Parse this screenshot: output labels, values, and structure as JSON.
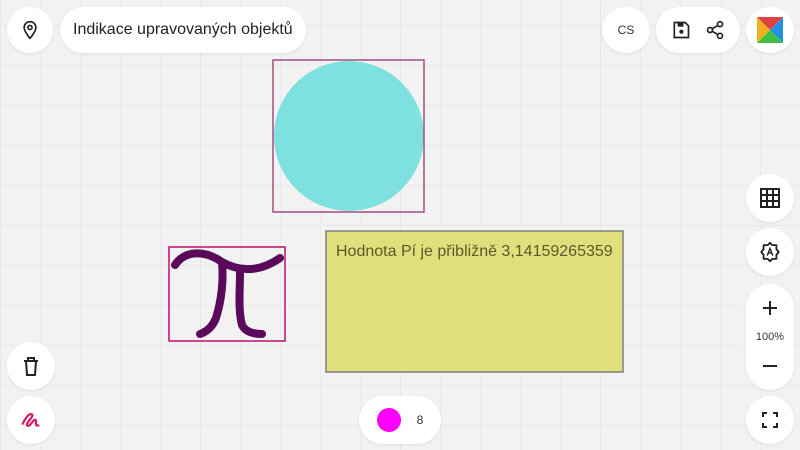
{
  "header": {
    "title": "Indikace upravovaných objektů",
    "language": "CS"
  },
  "zoom": {
    "level": "100%"
  },
  "pen": {
    "size": "8",
    "color": "#ff00ff"
  },
  "canvas": {
    "note_text": "Hodnota Pí je přibližně 3,14159265359",
    "colors": {
      "circle": "#7fe0e0",
      "circle_selection": "#a05080",
      "pi_stroke": "#5a0a5a",
      "pi_selection": "#c0106a",
      "note_fill": "#e0df7c",
      "note_border": "#808080"
    }
  },
  "icons": {
    "location": "location-pin-icon",
    "save": "floppy-save-icon",
    "share": "share-icon",
    "logo": "app-logo-icon",
    "grid": "grid-icon",
    "settings": "settings-gear-icon",
    "zoom_in": "plus-icon",
    "zoom_out": "minus-icon",
    "fullscreen": "fullscreen-icon",
    "delete": "trash-icon",
    "pen": "pen-squiggle-icon"
  }
}
